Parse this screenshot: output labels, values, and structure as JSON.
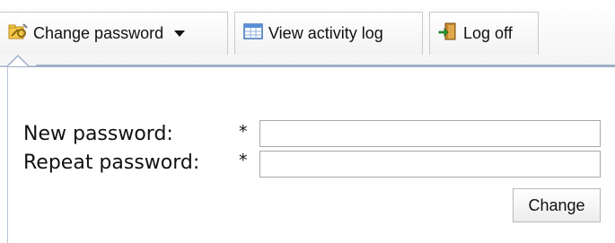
{
  "toolbar": {
    "change_password_label": "Change password",
    "activity_log_label": "View activity log",
    "log_off_label": "Log off",
    "icons": {
      "change_password": "key-folder-icon",
      "activity_log": "table-icon",
      "log_off": "door-exit-icon"
    }
  },
  "form": {
    "new_password_label": "New password:",
    "repeat_password_label": "Repeat password:",
    "required_marker": "*",
    "new_password_value": "",
    "repeat_password_value": "",
    "submit_label": "Change"
  },
  "colors": {
    "panel_border": "#9fb0c7",
    "button_border": "#c9c9c9"
  }
}
